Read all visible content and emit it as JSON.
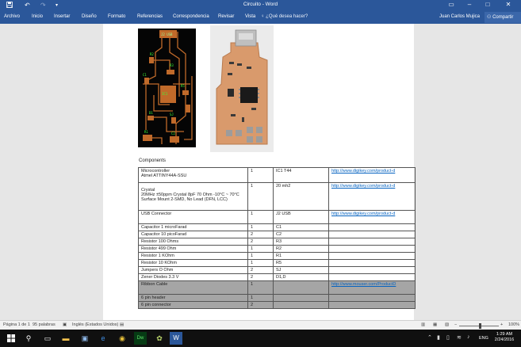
{
  "titlebar": {
    "title": "Circuito - Word",
    "save_icon": "save-icon",
    "undo_icon": "undo-icon",
    "redo_icon": "redo-icon"
  },
  "ribbon": {
    "tabs": [
      "Archivo",
      "Inicio",
      "Insertar",
      "Diseño",
      "Formato",
      "Referencias",
      "Correspondencia",
      "Revisar",
      "Vista"
    ],
    "tell_me": "¿Qué desea hacer?",
    "user": "Juan Carlos Mujica",
    "share": "Compartir"
  },
  "document": {
    "pcb_label": "J2 USB",
    "components_heading": "Components",
    "rows": [
      {
        "name": "Microcontroller",
        "name2": "Atmel ATTINY44A-SSU",
        "qty": "1",
        "ref": "IC1 T44",
        "link": "http://www.digikey.com/product-d",
        "gray": false
      },
      {
        "name": "Crystal",
        "name2": "20MHz ±50ppm Crystal 8pF 70 Ohm -10°C ~ 70°C",
        "name3": "Surface Mount 2-SMD, No Lead (DFN, LCC)",
        "qty": "1",
        "ref": "20 mh2",
        "link": "http://www.digikey.com/product-d",
        "gray": false
      },
      {
        "name": "USB Connector",
        "qty": "1",
        "ref": "J2 USB",
        "link": "http://www.digikey.com/product-d",
        "gray": false
      },
      {
        "name": "Capacitor 1 microFarad",
        "qty": "1",
        "ref": "C1",
        "link": "",
        "gray": false
      },
      {
        "name": "Capacitor 10 picoFarad",
        "qty": "2",
        "ref": "C2",
        "link": "",
        "gray": false
      },
      {
        "name": "Resistor 100 Ohms",
        "qty": "2",
        "ref": "R3",
        "link": "",
        "gray": false
      },
      {
        "name": "Resistor 499 Ohm",
        "qty": "1",
        "ref": "R2",
        "link": "",
        "gray": false
      },
      {
        "name": "Resistor 1 KOhm",
        "qty": "1",
        "ref": "R1",
        "link": "",
        "gray": false
      },
      {
        "name": "Resistor 10 KOhm",
        "qty": "1",
        "ref": "R5",
        "link": "",
        "gray": false
      },
      {
        "name": "Jumpers O Ohm",
        "qty": "2",
        "ref": "SJ",
        "link": "",
        "gray": false
      },
      {
        "name": "Zener Diodes 3.3 V",
        "qty": "2",
        "ref": "D1,D",
        "link": "",
        "gray": false
      },
      {
        "name": "Ribbon Cable",
        "qty": "1",
        "ref": "",
        "link": "http://www.mouser.com/ProductD",
        "gray": true
      },
      {
        "name": "6 pin header",
        "qty": "1",
        "ref": "",
        "link": "",
        "gray": true
      },
      {
        "name": "6 pin connector",
        "qty": "2",
        "ref": "",
        "link": "",
        "gray": true
      }
    ]
  },
  "statusbar": {
    "page": "Página 1 de 1",
    "words": "95 palabras",
    "language": "Inglés (Estados Unidos)",
    "zoom": "100%"
  },
  "taskbar": {
    "language": "ENG",
    "time": "1:29 AM",
    "date": "2/24/2016",
    "apps": [
      "windows-start-icon",
      "search-icon",
      "task-view-icon",
      "file-explorer-icon",
      "edge-icon",
      "chrome-icon",
      "dreamweaver-icon",
      "game-icon",
      "word-icon"
    ]
  },
  "colors": {
    "word_blue": "#2b579a",
    "link_blue": "#0563c1",
    "gray_row": "#a5a5a5",
    "pcb_trace": "#c06a2a",
    "pcb_label_green": "#39ff39"
  }
}
